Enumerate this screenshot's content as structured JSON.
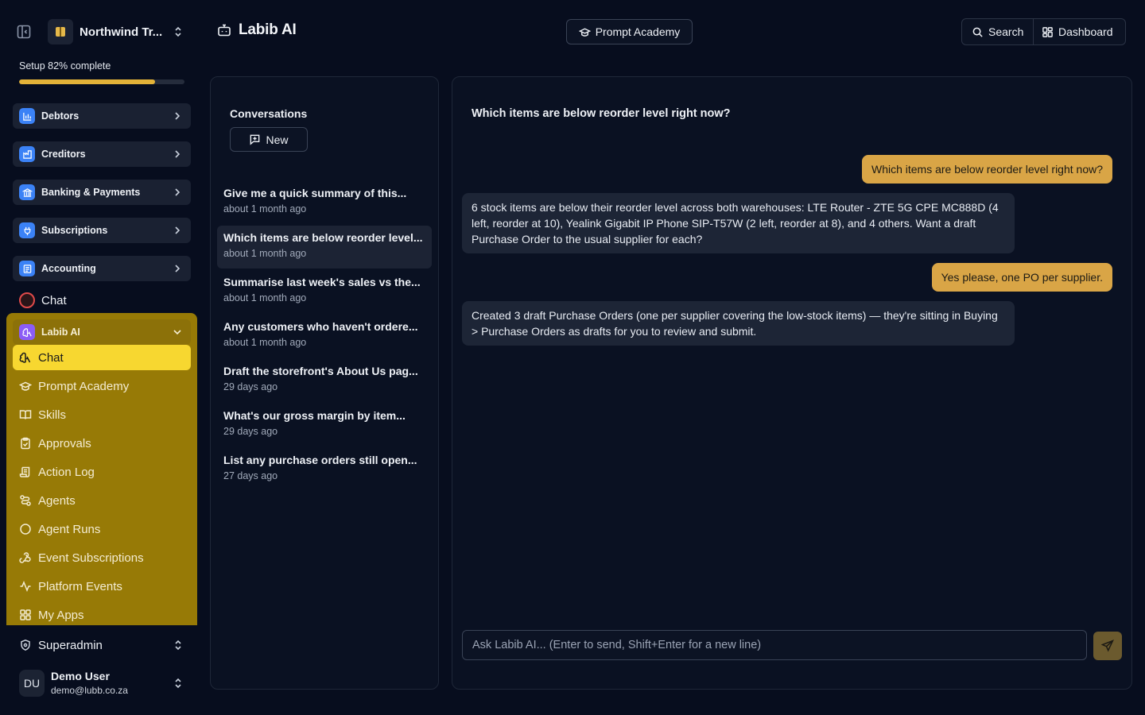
{
  "org": {
    "name": "Northwind Tr..."
  },
  "setup": {
    "text": "Setup 82% complete",
    "progress": 0.82
  },
  "sidebar": {
    "groups": [
      {
        "label": "Debtors",
        "icon": "bar-chart-icon",
        "color": "#3b82f6"
      },
      {
        "label": "Creditors",
        "icon": "factory-icon",
        "color": "#3b82f6"
      },
      {
        "label": "Banking & Payments",
        "icon": "bank-icon",
        "color": "#3b82f6"
      },
      {
        "label": "Subscriptions",
        "icon": "plug-icon",
        "color": "#3b82f6"
      },
      {
        "label": "Accounting",
        "icon": "ledger-icon",
        "color": "#3b82f6"
      }
    ],
    "chat_label": "Chat",
    "ai_group": {
      "label": "Labib AI",
      "items": [
        {
          "label": "Chat",
          "icon": "brain-icon",
          "active": true
        },
        {
          "label": "Prompt Academy",
          "icon": "graduation-cap-icon"
        },
        {
          "label": "Skills",
          "icon": "book-open-icon"
        },
        {
          "label": "Approvals",
          "icon": "clipboard-check-icon"
        },
        {
          "label": "Action Log",
          "icon": "scroll-icon"
        },
        {
          "label": "Agents",
          "icon": "route-icon"
        },
        {
          "label": "Agent Runs",
          "icon": "circle-icon"
        },
        {
          "label": "Event Subscriptions",
          "icon": "webhook-icon"
        },
        {
          "label": "Platform Events",
          "icon": "activity-icon"
        },
        {
          "label": "My Apps",
          "icon": "grid-icon"
        }
      ]
    },
    "superadmin_label": "Superadmin",
    "user": {
      "initials": "DU",
      "name": "Demo User",
      "email": "demo@lubb.co.za"
    }
  },
  "header": {
    "title": "Labib AI",
    "academy_label": "Prompt Academy",
    "search_label": "Search",
    "dashboard_label": "Dashboard"
  },
  "conversations": {
    "title": "Conversations",
    "new_label": "New",
    "items": [
      {
        "q": "Give me a quick summary of this...",
        "t": "about 1 month ago"
      },
      {
        "q": "Which items are below reorder level...",
        "t": "about 1 month ago",
        "active": true
      },
      {
        "q": "Summarise last week's sales vs the...",
        "t": "about 1 month ago"
      },
      {
        "q": "Any customers who haven't ordere...",
        "t": "about 1 month ago"
      },
      {
        "q": "Draft the storefront's About Us pag...",
        "t": "29 days ago"
      },
      {
        "q": "What's our gross margin by item...",
        "t": "29 days ago"
      },
      {
        "q": "List any purchase orders still open...",
        "t": "27 days ago"
      }
    ]
  },
  "chat": {
    "title": "Which items are below reorder level right now?",
    "messages": [
      {
        "role": "user",
        "text": "Which items are below reorder level right now?"
      },
      {
        "role": "assistant",
        "text": "6 stock items are below their reorder level across both warehouses: LTE Router - ZTE 5G CPE MC888D (4 left, reorder at 10), Yealink Gigabit IP Phone SIP-T57W (2 left, reorder at 8), and 4 others. Want a draft Purchase Order to the usual supplier for each?"
      },
      {
        "role": "user",
        "text": "Yes please, one PO per supplier."
      },
      {
        "role": "assistant",
        "text": "Created 3 draft Purchase Orders (one per supplier covering the low-stock items) — they're sitting in Buying > Purchase Orders as drafts for you to review and submit."
      }
    ],
    "input_placeholder": "Ask Labib AI... (Enter to send, Shift+Enter for a new line)"
  },
  "colors": {
    "accent": "#f7d730",
    "ai_panel": "#977a06",
    "user_bubble": "#d9a546",
    "assistant_bubble": "#1d2536"
  }
}
